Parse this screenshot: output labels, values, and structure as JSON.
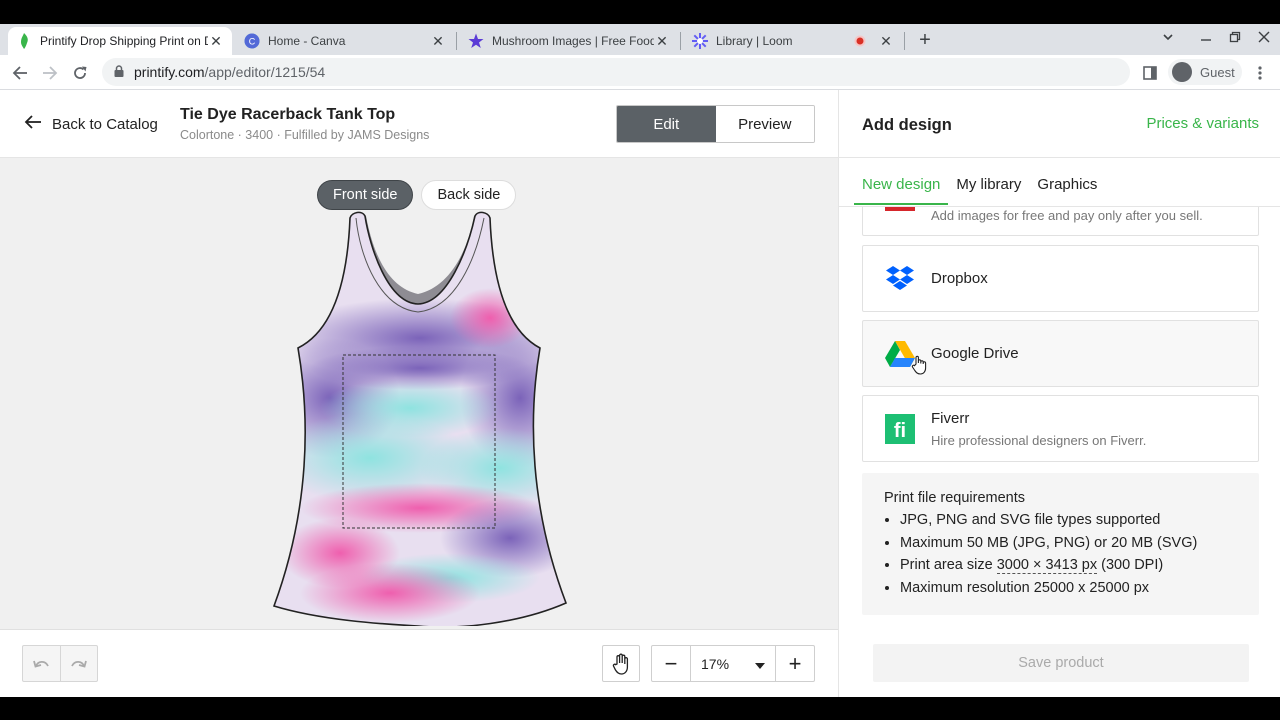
{
  "browser": {
    "tabs": [
      {
        "title": "Printify Drop Shipping Print on D",
        "icon": "printify-icon",
        "active": true
      },
      {
        "title": "Home - Canva",
        "icon": "canva-icon",
        "active": false
      },
      {
        "title": "Mushroom Images | Free Food &",
        "icon": "star-icon",
        "active": false
      },
      {
        "title": "Library | Loom",
        "icon": "loom-icon",
        "active": false
      }
    ],
    "url_host": "printify.com",
    "url_path": "/app/editor/1215/54",
    "profile_label": "Guest"
  },
  "header": {
    "back_label": "Back to Catalog",
    "product_title": "Tie Dye Racerback Tank Top",
    "product_sub": "Colortone · 3400 · Fulfilled by JAMS Designs",
    "edit_label": "Edit",
    "preview_label": "Preview"
  },
  "canvas": {
    "front_label": "Front side",
    "back_label": "Back side"
  },
  "bottom": {
    "zoom_value": "17%"
  },
  "panel": {
    "title": "Add design",
    "prices_link": "Prices & variants",
    "tabs": [
      "New design",
      "My library",
      "Graphics"
    ],
    "cards": [
      {
        "name": "",
        "desc": "Add images for free and pay only after you sell.",
        "icon": "shutterstock-icon"
      },
      {
        "name": "Dropbox",
        "desc": "",
        "icon": "dropbox-icon"
      },
      {
        "name": "Google Drive",
        "desc": "",
        "icon": "google-drive-icon"
      },
      {
        "name": "Fiverr",
        "desc": "Hire professional designers on Fiverr.",
        "icon": "fiverr-icon"
      }
    ],
    "requirements": {
      "title": "Print file requirements",
      "items": [
        "JPG, PNG and SVG file types supported",
        "Maximum 50 MB (JPG, PNG) or 20 MB (SVG)",
        "Print area size ",
        "Maximum resolution 25000 x 25000 px"
      ],
      "area_dims": "3000 × 3413 px",
      "area_dpi": " (300 DPI)"
    },
    "save_label": "Save product"
  },
  "colors": {
    "brand_green": "#39b54a",
    "dark_button": "#5b6166"
  }
}
